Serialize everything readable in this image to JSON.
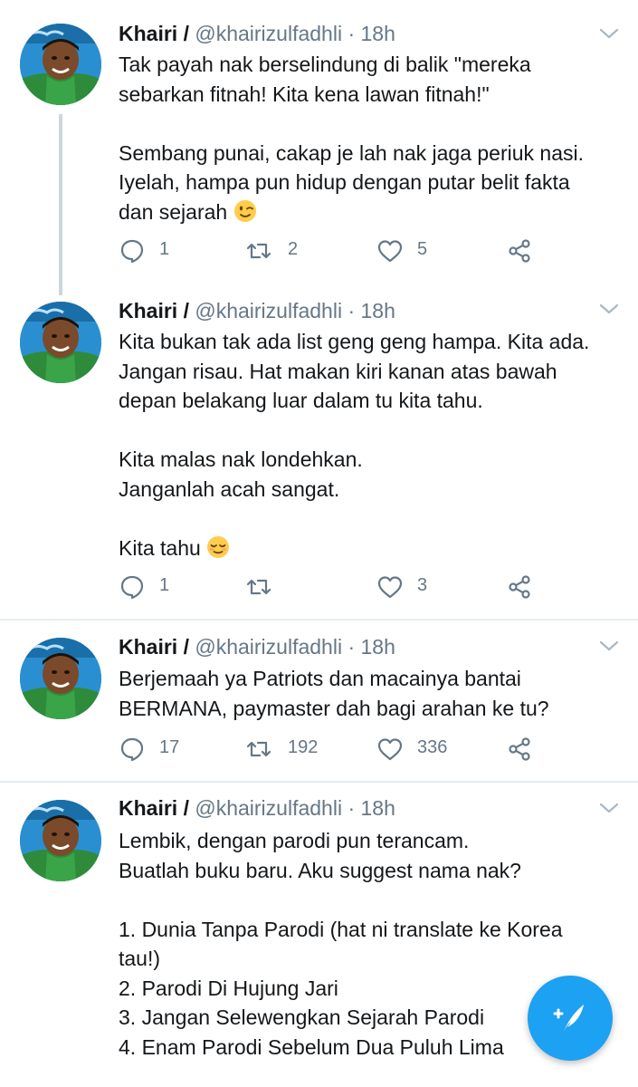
{
  "tweets": [
    {
      "name": "Khairi /",
      "handle": "@khairizulfadhli · 18h",
      "lines": [
        "Tak payah nak berselindung di balik \"mereka",
        "sebarkan fitnah! Kita kena lawan fitnah!\"",
        "",
        "Sembang punai, cakap je lah nak jaga periuk nasi.",
        "Iyelah, hampa pun hidup dengan putar belit fakta",
        "dan sejarah"
      ],
      "emoji": "winking-face-emoji",
      "reply_count": "1",
      "retweet_count": "2",
      "like_count": "5"
    },
    {
      "name": "Khairi /",
      "handle": "@khairizulfadhli · 18h",
      "lines": [
        "Kita bukan tak ada list geng geng hampa. Kita ada.",
        "Jangan risau. Hat makan kiri kanan atas bawah",
        "depan belakang luar dalam tu kita tahu.",
        "",
        "Kita malas nak londehkan.",
        "Janganlah acah sangat.",
        "",
        "Kita tahu"
      ],
      "emoji": "relieved-face-emoji",
      "reply_count": "1",
      "retweet_count": "",
      "like_count": "3"
    },
    {
      "name": "Khairi /",
      "handle": "@khairizulfadhli · 18h",
      "lines": [
        "Berjemaah ya Patriots dan macainya bantai",
        "BERMANA, paymaster dah bagi arahan ke tu?"
      ],
      "reply_count": "17",
      "retweet_count": "192",
      "like_count": "336"
    },
    {
      "name": "Khairi /",
      "handle": "@khairizulfadhli · 18h",
      "lines": [
        "Lembik, dengan parodi pun terancam.",
        "Buatlah buku baru. Aku suggest nama nak?",
        "",
        "1. Dunia Tanpa Parodi (hat ni translate ke Korea",
        "tau!)",
        "2. Parodi Di Hujung Jari",
        "3. Jangan Selewengkan Sejarah Parodi",
        "4. Enam Parodi Sebelum Dua Puluh Lima"
      ]
    }
  ],
  "icons": {
    "reply": "reply-icon",
    "retweet": "retweet-icon",
    "like": "heart-icon",
    "share": "share-icon",
    "caret": "chevron-down-icon",
    "compose": "compose-tweet-icon"
  },
  "colors": {
    "accent": "#1da1f2",
    "text": "#14171a",
    "secondary": "#657786",
    "divider": "#e6ecf0",
    "thread_line": "#ccd6dd"
  }
}
